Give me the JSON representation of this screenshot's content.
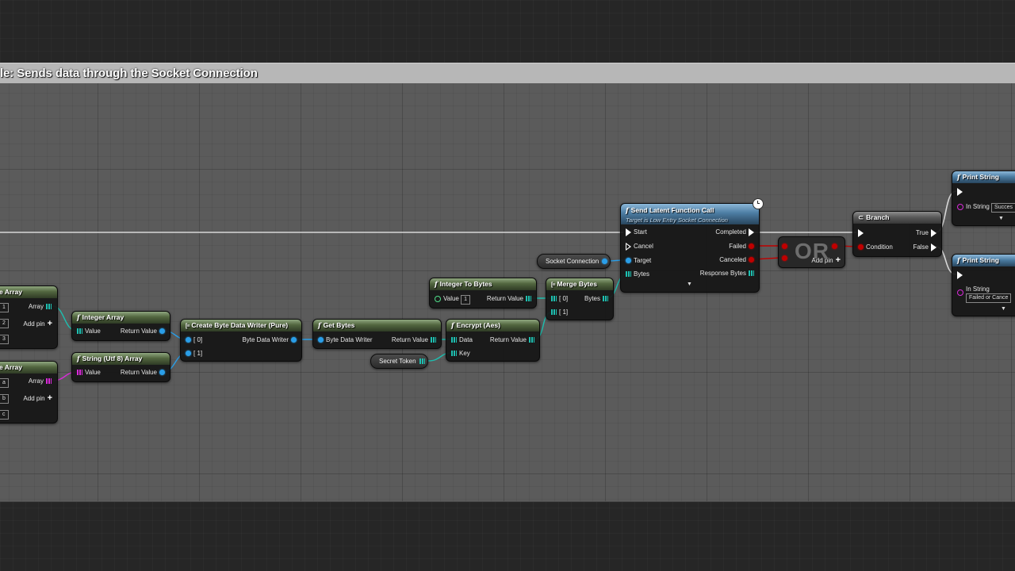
{
  "comment": {
    "title": "le: Sends data through the Socket Connection"
  },
  "byte_array": {
    "title": "e Array",
    "pin_out": "Array",
    "add_pin": "Add pin",
    "values": [
      "1",
      "2",
      "3"
    ]
  },
  "string_array": {
    "title": "e Array",
    "pin_out": "Array",
    "add_pin": "Add pin",
    "values": [
      "a",
      "b",
      "c"
    ]
  },
  "integer_array": {
    "title": "Integer Array",
    "pin_in": "Value",
    "pin_out": "Return Value"
  },
  "string_utf8_array": {
    "title": "String (Utf 8) Array",
    "pin_in": "Value",
    "pin_out": "Return Value"
  },
  "create_writer": {
    "title": "Create Byte Data Writer (Pure)",
    "pin_in_0": "[ 0]",
    "pin_in_1": "[ 1]",
    "pin_out": "Byte Data Writer"
  },
  "get_bytes": {
    "title": "Get Bytes",
    "pin_in": "Byte Data Writer",
    "pin_out": "Return Value"
  },
  "secret_token": {
    "label": "Secret Token"
  },
  "encrypt": {
    "title": "Encrypt (Aes)",
    "pin_data": "Data",
    "pin_key": "Key",
    "pin_out": "Return Value"
  },
  "integer_to_bytes": {
    "title": "Integer To Bytes",
    "pin_in": "Value",
    "value": "1",
    "pin_out": "Return Value"
  },
  "merge_bytes": {
    "title": "Merge Bytes",
    "pin_in_0": "[ 0]",
    "pin_in_1": "[ 1]",
    "pin_out": "Bytes"
  },
  "socket_connection": {
    "label": "Socket Connection"
  },
  "send_latent": {
    "title": "Send Latent Function Call",
    "subtitle": "Target is Low Entry Socket Connection",
    "inputs": [
      "Start",
      "Cancel",
      "Target",
      "Bytes"
    ],
    "outputs": [
      "Completed",
      "Failed",
      "Canceled",
      "Response Bytes"
    ]
  },
  "or_node": {
    "watermark": "OR",
    "add_pin": "Add pin"
  },
  "branch": {
    "title": "Branch",
    "pin_condition": "Condition",
    "out_true": "True",
    "out_false": "False"
  },
  "print_success": {
    "title": "Print String",
    "pin_in": "In String",
    "value": "Succes"
  },
  "print_failed": {
    "title": "Print String",
    "pin_in": "In String",
    "value": "Failed or Cance"
  },
  "colors": {
    "exec": "#ffffff",
    "byte": "#1dbfb0",
    "string": "#d92bd9",
    "object": "#2a9ee8",
    "bool": "#c00000",
    "comment_header": "#b7b7b7"
  }
}
